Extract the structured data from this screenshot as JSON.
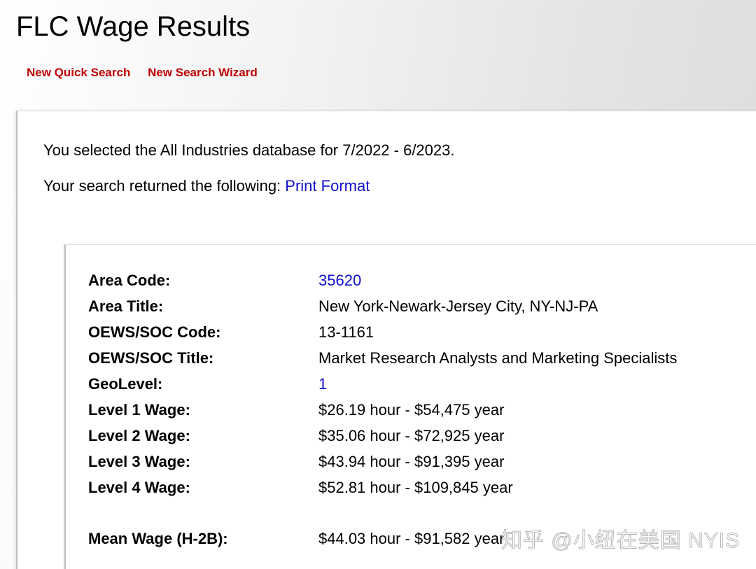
{
  "header": {
    "title": "FLC Wage Results",
    "links": [
      "New Quick Search",
      "New Search Wizard"
    ]
  },
  "intro": {
    "selected_text": "You selected the All Industries database for 7/2022 - 6/2023.",
    "returned_text": "Your search returned the following: ",
    "print_link": "Print Format"
  },
  "results": [
    {
      "label": "Area Code:",
      "value": "35620",
      "is_link": true
    },
    {
      "label": "Area Title:",
      "value": "New York-Newark-Jersey City, NY-NJ-PA",
      "is_link": false
    },
    {
      "label": "OEWS/SOC Code:",
      "value": "13-1161",
      "is_link": false
    },
    {
      "label": "OEWS/SOC Title:",
      "value": "Market Research Analysts and Marketing Specialists",
      "is_link": false
    },
    {
      "label": "GeoLevel:",
      "value": "1",
      "is_link": true
    },
    {
      "label": "Level 1 Wage:",
      "value": "$26.19 hour - $54,475 year",
      "is_link": false
    },
    {
      "label": "Level 2 Wage:",
      "value": "$35.06 hour - $72,925 year",
      "is_link": false
    },
    {
      "label": "Level 3 Wage:",
      "value": "$43.94 hour - $91,395 year",
      "is_link": false
    },
    {
      "label": "Level 4 Wage:",
      "value": "$52.81 hour - $109,845 year",
      "is_link": false
    },
    {
      "label": "Mean Wage (H-2B):",
      "value": "$44.03 hour - $91,582 year",
      "is_link": false
    }
  ],
  "watermark": "知乎 @小纽在美国 NYIS",
  "colors": {
    "link_red": "#c00000",
    "link_blue": "#1010cc"
  }
}
